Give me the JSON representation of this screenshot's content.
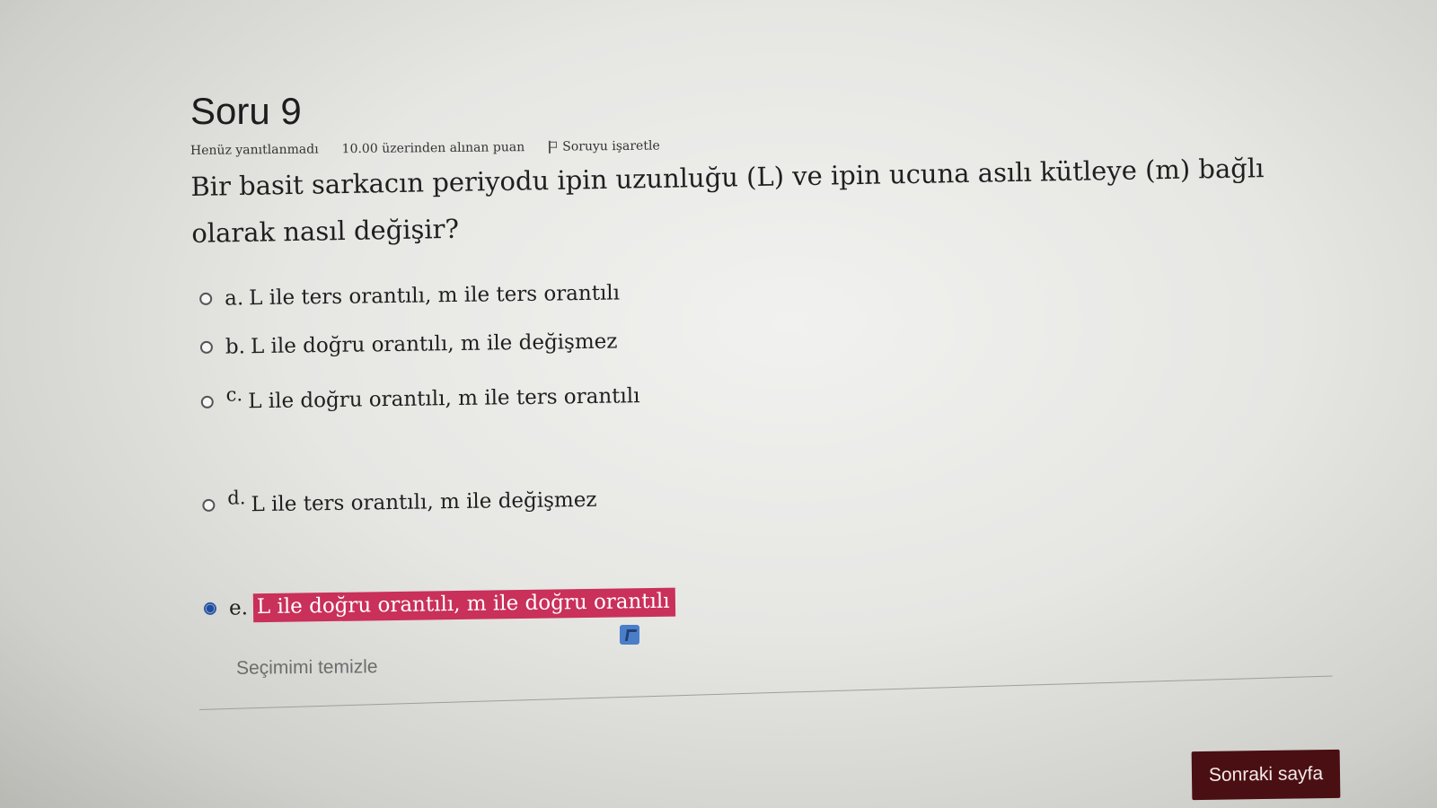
{
  "question": {
    "title": "Soru 9",
    "status": "Henüz yanıtlanmadı",
    "points": "10.00 üzerinden alınan puan",
    "flag_label": "Soruyu işaretle",
    "text": "Bir basit sarkacın periyodu ipin uzunluğu (L) ve ipin ucuna asılı kütleye (m) bağlı olarak nasıl değişir?"
  },
  "options": [
    {
      "letter": "a.",
      "text": "L ile ters orantılı, m ile ters orantılı",
      "selected": false
    },
    {
      "letter": "b.",
      "text": "L ile doğru orantılı, m ile değişmez",
      "selected": false
    },
    {
      "letter": "c.",
      "text": "L ile doğru orantılı, m ile ters orantılı",
      "selected": false
    },
    {
      "letter": "d.",
      "text": "L ile ters orantılı, m ile değişmez",
      "selected": false
    },
    {
      "letter": "e.",
      "text": "L ile doğru orantılı, m ile doğru orantılı",
      "selected": true
    }
  ],
  "clear_label": "Seçimimi temizle",
  "next_label": "Sonraki sayfa",
  "colors": {
    "selected_highlight": "#c9305a",
    "next_button": "#4a0f12",
    "radio_checked": "#1f4e9c"
  }
}
